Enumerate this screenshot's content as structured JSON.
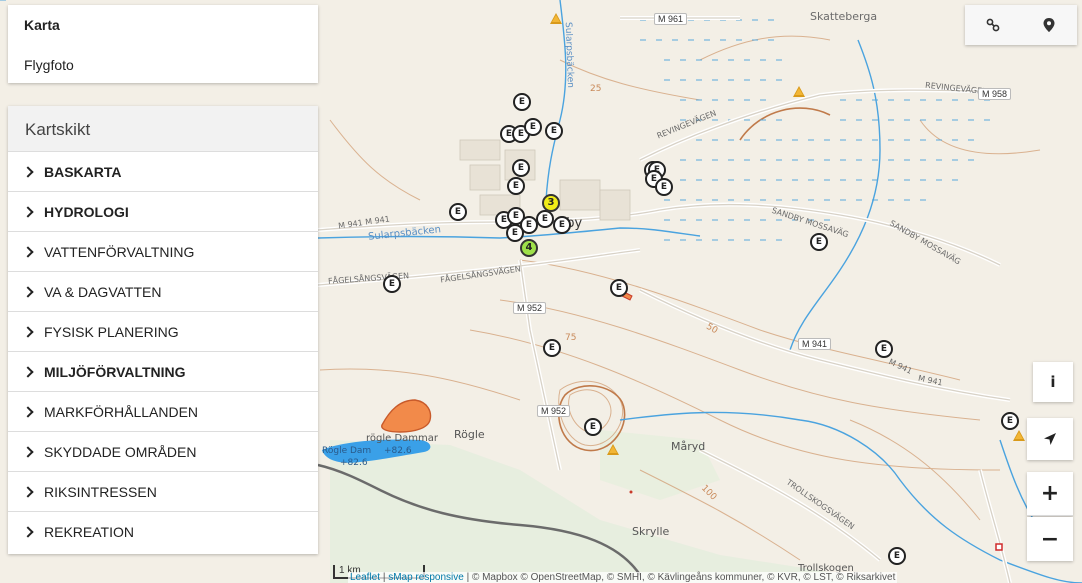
{
  "basemaps": {
    "option1": "Karta",
    "option2": "Flygfoto"
  },
  "layers": {
    "title": "Kartskikt",
    "items": [
      {
        "label": "BASKARTA",
        "bold": true
      },
      {
        "label": "HYDROLOGI",
        "bold": true
      },
      {
        "label": "VATTENFÖRVALTNING",
        "bold": false
      },
      {
        "label": "VA & DAGVATTEN",
        "bold": false
      },
      {
        "label": "FYSISK PLANERING",
        "bold": false
      },
      {
        "label": "MILJÖFÖRVALTNING",
        "bold": true
      },
      {
        "label": "MARKFÖRHÅLLANDEN",
        "bold": false
      },
      {
        "label": "SKYDDADE OMRÅDEN",
        "bold": false
      },
      {
        "label": "RIKSINTRESSEN",
        "bold": false
      },
      {
        "label": "REKREATION",
        "bold": false
      }
    ]
  },
  "controls": {
    "info": "i",
    "zoom_in": "+",
    "zoom_out": "−"
  },
  "map_labels": {
    "town": "dby",
    "skatteberga": "Skatteberga",
    "revingevagen1": "REVINGEVÄGEN",
    "revingevagen2": "REVINGEVÄGEN",
    "sandby_mossavag1": "SANDBY MOSSAVÄG",
    "sandby_mossavag2": "SANDBY MOSSAVÄG",
    "fagelsangsvagen": "FÅGELSÅNGSVÄGEN",
    "sularpsbacken": "Sularpsbäcken",
    "sularpsbacken2": "Sularpsbäcken",
    "m941_left": "M 941  M 941",
    "m941_right": "M 941",
    "m941_lower": "M 941",
    "rogle": "Rögle",
    "rogle_dammar": "rögle Dammar",
    "rogle_dam": "Rögle Dam",
    "elev1": "+82.6",
    "elev2": "+82.6",
    "maryd": "Måryd",
    "skrylle": "Skrylle",
    "trollskogen": "Trollskogen",
    "trollskogsvagen": "TROLLSKOGSVÄGEN",
    "contour75": "75",
    "contour50": "50",
    "contour100": "100",
    "contour25": "25"
  },
  "road_shields": {
    "m961": "M 961",
    "m958": "M 958",
    "m952a": "M 952",
    "m952b": "M 952",
    "m941": "M 941"
  },
  "markers": {
    "e_label": "E",
    "cluster_yellow": "3",
    "cluster_green": "4"
  },
  "scale": {
    "label": "1 km"
  },
  "attribution": {
    "leaflet": "Leaflet",
    "smap": "sMap responsive",
    "rest": "| © Mapbox © OpenStreetMap, © SMHI, © Kävlingeåns kommuner, © KVR, © LST, © Riksarkivet"
  },
  "colors": {
    "water_line": "#4aa3df",
    "road_major": "#555555",
    "contour": "#c98a5a",
    "lake": "#3aa0e8",
    "area_orange": "#f28a4a"
  }
}
